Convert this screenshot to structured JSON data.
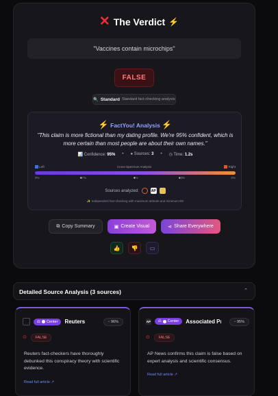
{
  "header": {
    "title": "The Verdict"
  },
  "claim": {
    "text": "\"Vaccines contain microchips\""
  },
  "verdict": {
    "label": "FALSE"
  },
  "mode": {
    "name": "Standard",
    "description": "Standard fact-checking analysis"
  },
  "analysis": {
    "title": "FactYou! Analysis",
    "quote": "\"This claim is more fictional than my dating profile. We're 95% confident, which is more certain than most people are about their own names.\"",
    "confidence_label": "Confidence:",
    "confidence_value": "95%",
    "sources_label": "Sources:",
    "sources_value": "3",
    "time_label": "Time:",
    "time_value": "1.2s",
    "spectrum": {
      "left": "Left",
      "title": "Cross-Spectrum Analysis",
      "right": "Right",
      "ticks": [
        "0%",
        "67%",
        "0%",
        "33%",
        "0%"
      ]
    },
    "sources_analyzed_label": "Sources analyzed:",
    "footnote": "Independent fact-checking with maximum attitude and minimum BS"
  },
  "actions": {
    "copy": "Copy Summary",
    "visual": "Create Visual",
    "share": "Share Everywhere"
  },
  "details": {
    "title": "Detailed Source Analysis (3 sources)"
  },
  "sources": [
    {
      "name": "Reuters",
      "bias": "Center",
      "score": "96%",
      "verdict": "FALSE",
      "desc_lines": [
        "Reuters fact-checkers have thoroughly",
        "debunked this conspiracy theory with scientific",
        "evidence."
      ],
      "link": "Read full article"
    },
    {
      "name": "Associated Pr...",
      "bias": "Center",
      "score": "95%",
      "verdict": "FALSE",
      "logo": "AP",
      "desc_lines": [
        "AP News confirms this claim is false based on",
        "expert analysis and scientific consensus."
      ],
      "link": "Read full article"
    }
  ],
  "colors": {
    "false_red": "#ef2d3a",
    "accent_purple": "#7b45d8",
    "accent_pink": "#e2587f",
    "link_blue": "#6e8bff"
  }
}
